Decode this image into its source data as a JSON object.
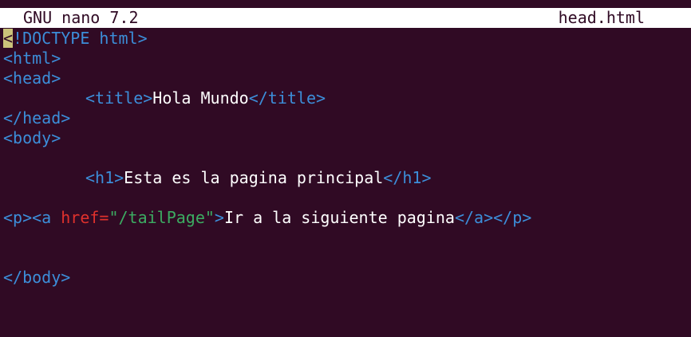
{
  "titlebar": {
    "app": "GNU nano 7.2",
    "file": "head.html"
  },
  "editor": {
    "line1": {
      "cursor_char": "<",
      "rest": "!DOCTYPE html>"
    },
    "line2": {
      "text": "<html>"
    },
    "line3": {
      "text": "<head>"
    },
    "line4": {
      "open": "<title>",
      "content": "Hola Mundo",
      "close": "</title>"
    },
    "line5": {
      "text": "</head>"
    },
    "line6": {
      "text": "<body>"
    },
    "line8": {
      "open": "<h1>",
      "content": "Esta es la pagina principal",
      "close": "</h1>"
    },
    "line10": {
      "open_p_a": "<p><a ",
      "attr": "href=",
      "value": "\"/tailPage\"",
      "gt": ">",
      "content": "Ir a la siguiente pagina",
      "close": "</a></p>"
    },
    "line13": {
      "text": "</body>"
    }
  },
  "colors": {
    "background": "#300a24",
    "tag": "#3c8ed9",
    "attribute": "#e0312c",
    "string": "#3cac62",
    "cursor": "#cbc37a"
  }
}
